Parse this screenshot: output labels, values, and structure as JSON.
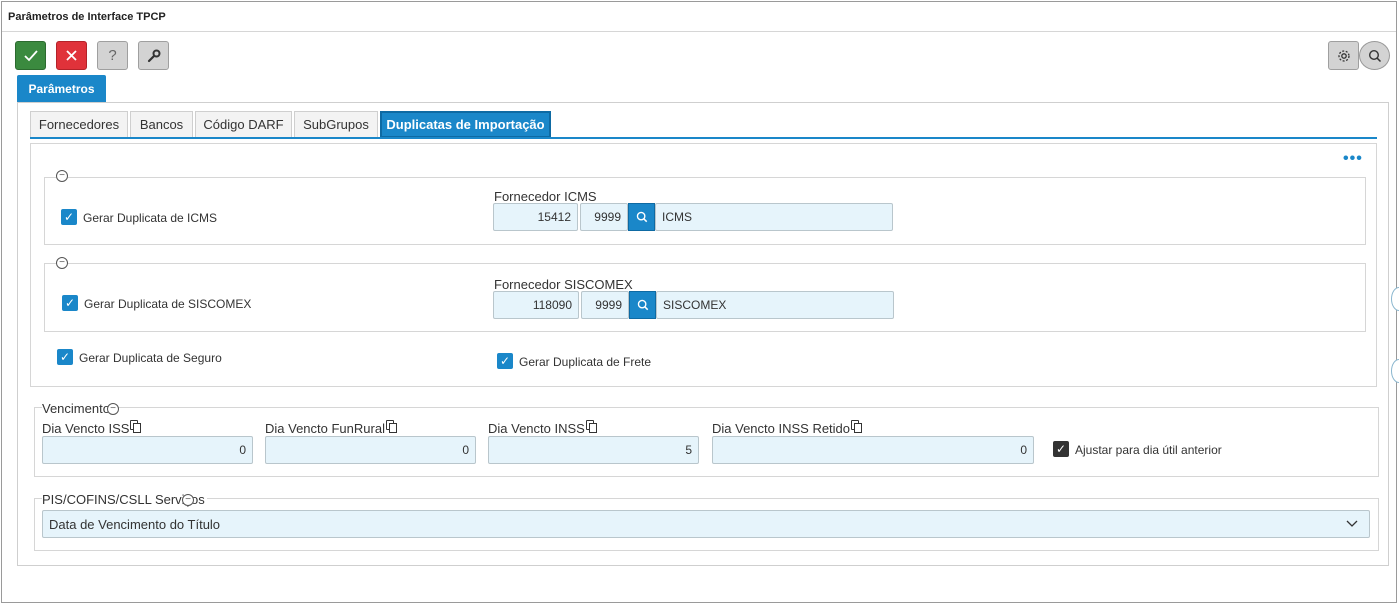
{
  "window": {
    "title": "Parâmetros de Interface TPCP"
  },
  "main_tab": {
    "label": "Parâmetros"
  },
  "subtabs": [
    {
      "label": "Fornecedores"
    },
    {
      "label": "Bancos"
    },
    {
      "label": "Código DARF"
    },
    {
      "label": "SubGrupos"
    },
    {
      "label": "Duplicatas de Importação"
    }
  ],
  "icms": {
    "checkbox_label": "Gerar Duplicata de ICMS",
    "supplier_label": "Fornecedor ICMS",
    "code": "15412",
    "branch": "9999",
    "name": "ICMS"
  },
  "siscomex": {
    "checkbox_label": "Gerar Duplicata de SISCOMEX",
    "supplier_label": "Fornecedor SISCOMEX",
    "code": "118090",
    "branch": "9999",
    "name": "SISCOMEX"
  },
  "seguro": {
    "checkbox_label": "Gerar Duplicata de Seguro"
  },
  "frete": {
    "checkbox_label": "Gerar Duplicata de Frete"
  },
  "vencimento": {
    "legend": "Vencimento",
    "iss": {
      "label": "Dia Vencto ISS",
      "value": "0"
    },
    "funrural": {
      "label": "Dia Vencto FunRural",
      "value": "0"
    },
    "inss": {
      "label": "Dia Vencto INSS",
      "value": "5"
    },
    "inss_retido": {
      "label": "Dia Vencto INSS Retido",
      "value": "0"
    },
    "ajustar_label": "Ajustar para dia útil anterior"
  },
  "pis": {
    "legend": "PIS/COFINS/CSLL Serviços",
    "selected": "Data de Vencimento do Título"
  },
  "colors": {
    "accent": "#1a87c9",
    "ok": "#3b8a3f",
    "cancel": "#e0323a",
    "input_bg": "#e6f4fb"
  }
}
